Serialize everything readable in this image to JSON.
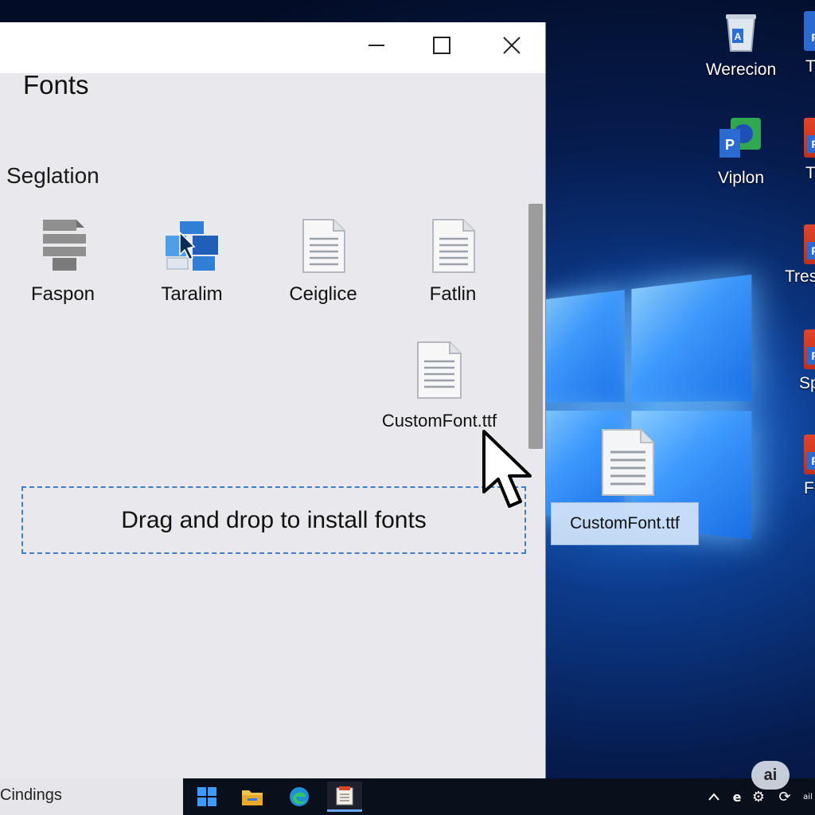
{
  "desktop": {
    "icons": [
      {
        "label": "Werecion",
        "icon": "recycle-bin-icon"
      },
      {
        "label": "Viplon",
        "icon": "app-icon"
      },
      {
        "label": "T",
        "icon": "powerpoint-icon"
      },
      {
        "label": "Tr",
        "icon": "powerpoint-icon"
      },
      {
        "label": "Tres",
        "icon": "powerpoint-icon"
      },
      {
        "label": "Sp",
        "icon": "powerpoint-icon"
      },
      {
        "label": "Fo",
        "icon": "powerpoint-icon"
      }
    ],
    "drag_ghost_label": "CustomFont.ttf"
  },
  "window": {
    "title": "Fonts",
    "controls": {
      "minimize": "minimize-icon",
      "maximize": "maximize-icon",
      "close": "close-icon"
    },
    "section_title": "Seglation",
    "fonts": [
      {
        "name": "Faspon",
        "icon": "font-printer-icon"
      },
      {
        "name": "Taralim",
        "icon": "font-blue-icon"
      },
      {
        "name": "Ceiglice",
        "icon": "document-icon"
      },
      {
        "name": "Fatlin",
        "icon": "document-icon"
      }
    ],
    "dragged_file": "CustomFont.ttf",
    "drop_zone_text": "Drag and drop to install fonts"
  },
  "taskbar": {
    "search_text": "Cindings",
    "apps": [
      "windows-start-icon",
      "file-explorer-icon",
      "edge-icon",
      "fonts-app-icon"
    ],
    "tray_badge": "ai",
    "tray_text": "ail"
  },
  "colors": {
    "accent": "#3f7fc4",
    "window_bg": "#e9e8ec",
    "taskbar": "#0a0f1c"
  }
}
